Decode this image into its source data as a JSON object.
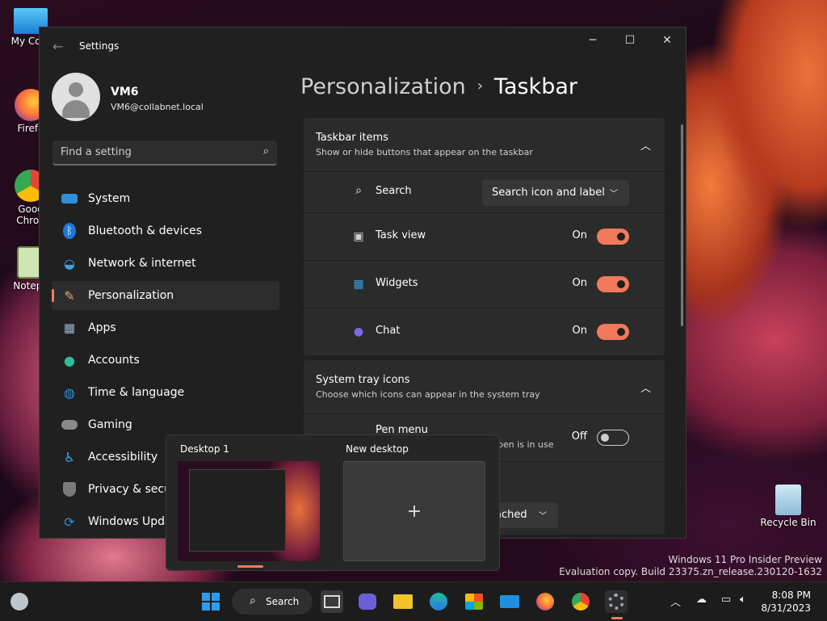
{
  "desktop": {
    "icons": [
      {
        "label": "My Com",
        "icon": "computer-icon"
      },
      {
        "label": "Firefo",
        "icon": "firefox-icon"
      },
      {
        "label": "Goog Chron",
        "icon": "chrome-icon"
      },
      {
        "label": "Notepa",
        "icon": "notepad-icon"
      },
      {
        "label": "Recycle Bin",
        "icon": "recycle-bin-icon"
      }
    ],
    "watermark_line1": "Windows 11 Pro Insider Preview",
    "watermark_line2": "Evaluation copy. Build 23375.zn_release.230120-1632"
  },
  "window": {
    "title": "Settings",
    "back_glyph": "←",
    "minimize_glyph": "─",
    "maximize_glyph": "☐",
    "close_glyph": "✕"
  },
  "profile": {
    "name": "VM6",
    "email": "VM6@collabnet.local"
  },
  "search": {
    "placeholder": "Find a setting",
    "icon_glyph": "⌕"
  },
  "nav": [
    {
      "label": "System",
      "icon": "system-icon",
      "color": "#2f8fd8"
    },
    {
      "label": "Bluetooth & devices",
      "icon": "bluetooth-icon",
      "color": "#1d78d6"
    },
    {
      "label": "Network & internet",
      "icon": "wifi-icon",
      "color": "#3aa0e8"
    },
    {
      "label": "Personalization",
      "icon": "brush-icon",
      "color": "#e0a46a",
      "selected": true
    },
    {
      "label": "Apps",
      "icon": "apps-icon",
      "color": "#6b8fb0"
    },
    {
      "label": "Accounts",
      "icon": "accounts-icon",
      "color": "#2dbf9a"
    },
    {
      "label": "Time & language",
      "icon": "globe-icon",
      "color": "#2f8fd8"
    },
    {
      "label": "Gaming",
      "icon": "gamepad-icon",
      "color": "#8a8a8a"
    },
    {
      "label": "Accessibility",
      "icon": "accessibility-icon",
      "color": "#3aa0e8"
    },
    {
      "label": "Privacy & securi",
      "icon": "shield-icon",
      "color": "#7a7a7a"
    },
    {
      "label": "Windows Updat",
      "icon": "update-icon",
      "color": "#2f8fd8"
    }
  ],
  "breadcrumb": {
    "parent": "Personalization",
    "separator": "›",
    "current": "Taskbar"
  },
  "taskbar_items": {
    "title": "Taskbar items",
    "subtitle": "Show or hide buttons that appear on the taskbar",
    "collapse_glyph": "︿",
    "search_row": {
      "label": "Search",
      "icon_glyph": "⌕",
      "dropdown_value": "Search icon and label",
      "dropdown_glyph": "﹀"
    },
    "rows": [
      {
        "label": "Task view",
        "state": "On",
        "icon": "task-view-icon",
        "glyph": "▣",
        "color": "#cfcfcf"
      },
      {
        "label": "Widgets",
        "state": "On",
        "icon": "widgets-icon",
        "glyph": "▦",
        "color": "#3aa0e8"
      },
      {
        "label": "Chat",
        "state": "On",
        "icon": "chat-icon",
        "glyph": "●",
        "color": "#7b68ee"
      }
    ]
  },
  "system_tray": {
    "title": "System tray icons",
    "subtitle": "Choose which icons can appear in the system tray",
    "collapse_glyph": "︿",
    "pen_row": {
      "label": "Pen menu",
      "sub": "pen is in use",
      "state": "Off"
    },
    "partial_dropdown": "ached",
    "dropdown_glyph": "﹀"
  },
  "task_view": {
    "desktop1": "Desktop 1",
    "new_desktop": "New desktop",
    "add_glyph": "+"
  },
  "taskbar": {
    "search_label": "Search",
    "search_glyph": "⌕",
    "tray_chevron": "︿",
    "clock_time": "8:08 PM",
    "clock_date": "8/31/2023",
    "accent": "#f27c57"
  }
}
